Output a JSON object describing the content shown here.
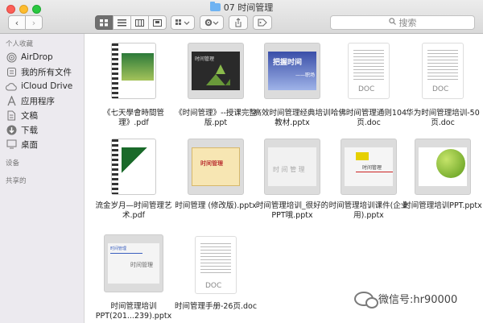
{
  "window": {
    "title": "07 时间管理"
  },
  "toolbar": {
    "back": "‹",
    "forward": "›",
    "search_placeholder": "搜索"
  },
  "sidebar": {
    "favorites_header": "个人收藏",
    "items": [
      {
        "label": "AirDrop",
        "icon": "airdrop-icon"
      },
      {
        "label": "我的所有文件",
        "icon": "all-files-icon"
      },
      {
        "label": "iCloud Drive",
        "icon": "cloud-icon"
      },
      {
        "label": "应用程序",
        "icon": "applications-icon"
      },
      {
        "label": "文稿",
        "icon": "documents-icon"
      },
      {
        "label": "下载",
        "icon": "downloads-icon"
      },
      {
        "label": "桌面",
        "icon": "desktop-icon"
      }
    ],
    "devices_header": "设备",
    "shared_header": "共享的"
  },
  "files": [
    {
      "name": "《七天學會時間管理》.pdf",
      "type": "pdf"
    },
    {
      "name": "《时间管理》--授课完整版.ppt",
      "type": "ppt"
    },
    {
      "name": "高效时间管理经典培训教材.pptx",
      "type": "pptx"
    },
    {
      "name": "哈佛时间管理通则104页.doc",
      "type": "doc"
    },
    {
      "name": "华为时间管理培训-50页.doc",
      "type": "doc"
    },
    {
      "name": "流金岁月—时间管理艺术.pdf",
      "type": "pdf"
    },
    {
      "name": "时间管理 (修改版).pptx",
      "type": "pptx"
    },
    {
      "name": "时间管理培训_很好的PPT哦.pptx",
      "type": "pptx"
    },
    {
      "name": "时间管理培训课件(企业用).pptx",
      "type": "pptx"
    },
    {
      "name": "时间管理培训PPT.pptx",
      "type": "pptx"
    },
    {
      "name": "时间管理培训PPT(201...239).pptx",
      "type": "pptx"
    },
    {
      "name": "时间管理手册-26页.doc",
      "type": "doc"
    }
  ],
  "thumb_text": {
    "doc_badge": "DOC",
    "slide3_title": "把握时间",
    "slide3_sub": "——职场",
    "slide4_title": "时间管理",
    "slide7_title": "时间管理",
    "slide8_title": "时 间 管 理",
    "slide9_title": "时间管理",
    "slide11_tag": "时间管理",
    "slide11_title": "时间管理"
  },
  "watermark": {
    "text": "微信号:hr90000"
  }
}
